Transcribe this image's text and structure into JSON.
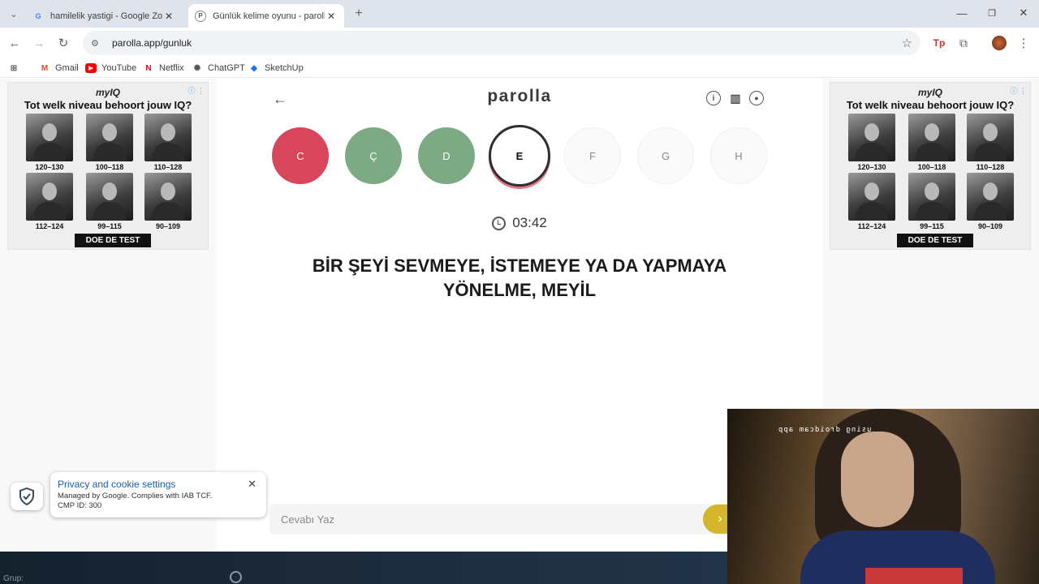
{
  "browser": {
    "tabs": [
      {
        "title": "hamilelik yastigi - Google Zoeke",
        "favicon": "G"
      },
      {
        "title": "Günlük kelime oyunu - parolla",
        "favicon": "P"
      }
    ],
    "url": "parolla.app/gunluk",
    "bookmarks": [
      {
        "label": "Gmail",
        "icon": "gmail-icon"
      },
      {
        "label": "YouTube",
        "icon": "youtube-icon"
      },
      {
        "label": "Netflix",
        "icon": "netflix-icon"
      },
      {
        "label": "ChatGPT",
        "icon": "chatgpt-icon"
      },
      {
        "label": "SketchUp",
        "icon": "sketchup-icon"
      }
    ],
    "extension_label": "Tp"
  },
  "ads": [
    {
      "brand": "myIQ",
      "headline": "Tot welk niveau behoort jouw IQ?",
      "ranges": [
        "120–130",
        "100–118",
        "110–128",
        "112–124",
        "99–115",
        "90–109"
      ],
      "cta": "DOE DE TEST"
    },
    {
      "brand": "myIQ",
      "headline": "Tot welk niveau behoort jouw IQ?",
      "ranges": [
        "120–130",
        "100–118",
        "110–128",
        "112–124",
        "99–115",
        "90–109"
      ],
      "cta": "DOE DE TEST"
    }
  ],
  "game": {
    "logo": "parolla",
    "letters": [
      {
        "char": "C",
        "status": "wrong"
      },
      {
        "char": "Ç",
        "status": "correct"
      },
      {
        "char": "D",
        "status": "correct"
      },
      {
        "char": "E",
        "status": "current"
      },
      {
        "char": "F",
        "status": "pending"
      },
      {
        "char": "G",
        "status": "pending"
      },
      {
        "char": "H",
        "status": "pending"
      }
    ],
    "timer": "03:42",
    "question": "BİR ŞEYİ SEVMEYE, İSTEMEYE YA DA YAPMAYA YÖNELME, MEYİL",
    "answer_placeholder": "Cevabı Yaz",
    "answer_value": "",
    "colors": {
      "wrong": "#d9455b",
      "correct": "#7caa83",
      "submit": "#d4b52c"
    }
  },
  "cookie": {
    "title": "Privacy and cookie settings",
    "line1": "Managed by Google. Complies with IAB TCF.",
    "line2": "CMP ID: 300"
  },
  "webcam": {
    "watermark": "using droidcam app"
  },
  "bottom": {
    "label": "Grup:"
  }
}
